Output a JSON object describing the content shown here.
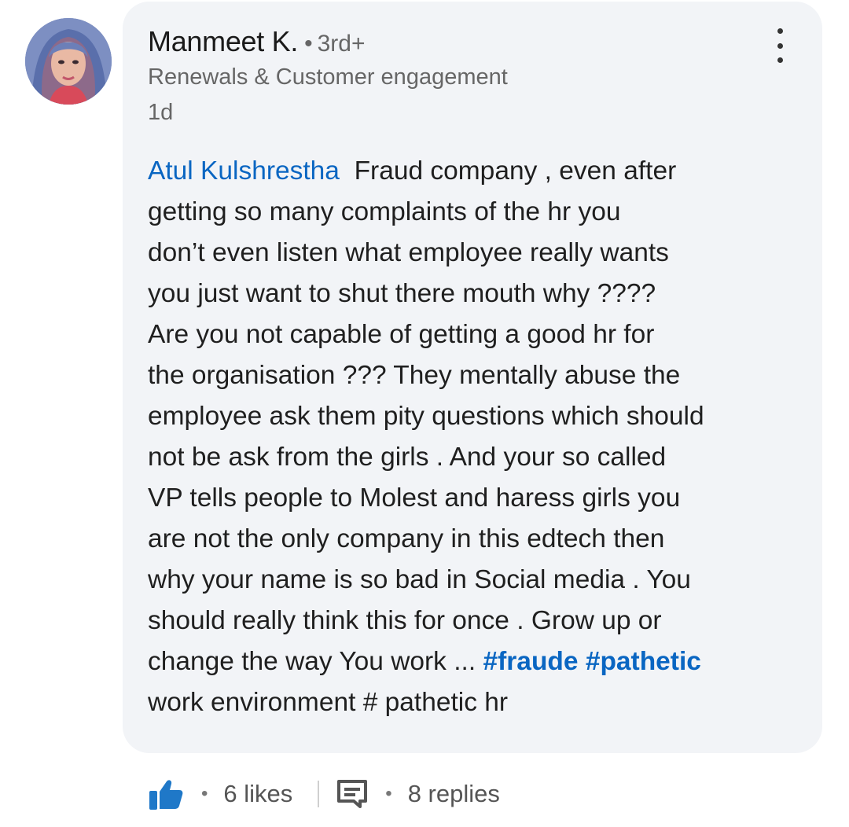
{
  "comment": {
    "author": {
      "name": "Manmeet K.",
      "separator": "•",
      "degree": "3rd+",
      "headline": "Renewals & Customer engagement",
      "time": "1d"
    },
    "mention": "Atul Kulshrestha",
    "lines": [
      "Fraud company , even after",
      "getting so many complaints of the hr you",
      "don’t even listen what employee really wants",
      "you just want to shut there mouth why ????",
      "Are you not capable of getting a good hr for",
      "the organisation ??? They mentally abuse the",
      "employee ask them pity questions which should",
      "not be ask from the girls . And your so called",
      "VP tells people to Molest and haress girls you",
      "are not the only company in this edtech then",
      "why your name is so bad in Social media . You",
      "should really think this for once . Grow up or",
      "change the way You work ... ",
      "work environment # pathetic hr"
    ],
    "hashtags": [
      "#fraude",
      "#pathetic"
    ],
    "likes": "6 likes",
    "replies": "8 replies",
    "dot": "•"
  },
  "icons": {
    "like": "thumbs-up-icon",
    "reply": "comment-icon",
    "more": "three-dots-vertical-icon"
  },
  "colors": {
    "link": "#0a66c2",
    "bubble": "#f2f4f7",
    "muted": "#666666"
  }
}
